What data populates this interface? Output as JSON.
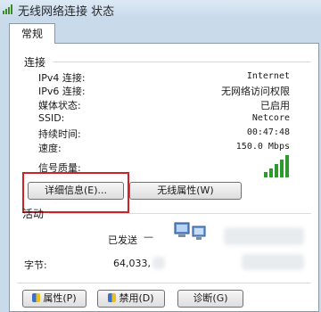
{
  "window": {
    "title": "无线网络连接 状态",
    "icon": "wifi-status-icon"
  },
  "tabs": [
    {
      "label": "常规"
    }
  ],
  "connection": {
    "heading": "连接",
    "rows": [
      {
        "label": "IPv4 连接:",
        "value": "Internet"
      },
      {
        "label": "IPv6 连接:",
        "value": "无网络访问权限"
      },
      {
        "label": "媒体状态:",
        "value": "已启用"
      },
      {
        "label": "SSID:",
        "value": "Netcore"
      },
      {
        "label": "持续时间:",
        "value": "00:47:48"
      },
      {
        "label": "速度:",
        "value": "150.0 Mbps"
      }
    ],
    "signal_label": "信号质量:",
    "signal_icon": "signal-bars-icon",
    "details_button": "详细信息(E)...",
    "wireless_props_button": "无线属性(W)",
    "highlight_color": "#d0202a"
  },
  "activity": {
    "heading": "活动",
    "sent_label": "已发送",
    "sent_dash": "—",
    "bytes_label": "字节:",
    "bytes_sent": "64,033,",
    "network_icon": "network-computers-icon"
  },
  "footer_buttons": [
    {
      "label": "属性(P)",
      "icon": "shield-icon"
    },
    {
      "label": "禁用(D)",
      "icon": "shield-icon"
    },
    {
      "label": "诊断(G)",
      "icon": ""
    }
  ]
}
